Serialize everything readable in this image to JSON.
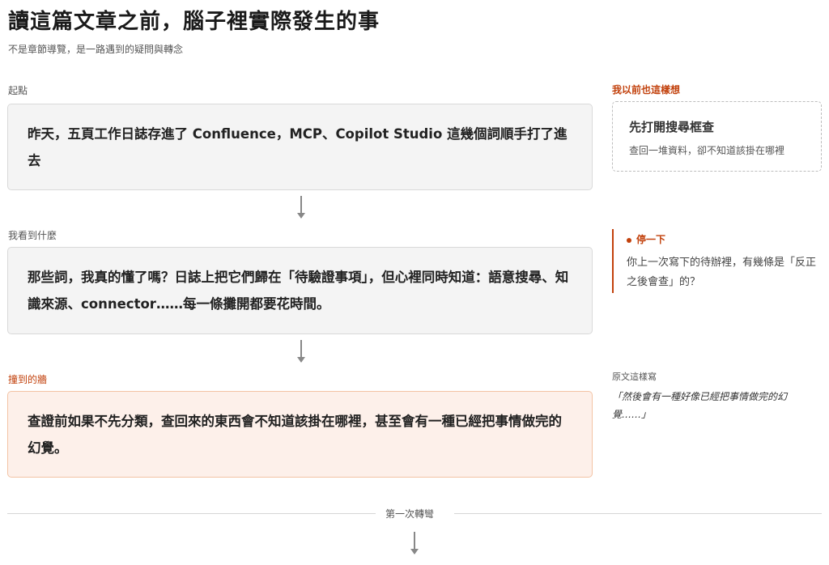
{
  "header": {
    "title": "讀這篇文章之前，腦子裡實際發生的事",
    "subtitle": "不是章節導覽，是一路遇到的疑問與轉念"
  },
  "steps": [
    {
      "label": "起點",
      "text": "昨天，五頁工作日誌存進了 Confluence，MCP、Copilot Studio 這幾個詞順手打了進去"
    },
    {
      "label": "我看到什麼",
      "text": "那些詞，我真的懂了嗎？日誌上把它們歸在「待驗證事項」，但心裡同時知道：語意搜尋、知識來源、connector……每一條攤開都要花時間。"
    },
    {
      "label": "撞到的牆",
      "text": "查證前如果不先分類，查回來的東西會不知道該掛在哪裡，甚至會有一種已經把事情做完的幻覺。"
    }
  ],
  "side": {
    "me_too": {
      "heading": "我以前也這樣想",
      "title": "先打開搜尋框查",
      "sub": "查回一堆資料，卻不知道該掛在哪裡"
    },
    "pause": {
      "heading": "停一下",
      "text": "你上一次寫下的待辦裡，有幾條是「反正之後會查」的？"
    },
    "quote": {
      "label": "原文這樣寫",
      "text": "「然後會有一種好像已經把事情做完的幻覺……」"
    }
  },
  "divider": {
    "label": "第一次轉彎"
  },
  "colors": {
    "accent": "#c2410c",
    "card_bg": "#f4f4f4",
    "wall_bg": "#fdf0ea",
    "wall_border": "#f3c3a4"
  }
}
